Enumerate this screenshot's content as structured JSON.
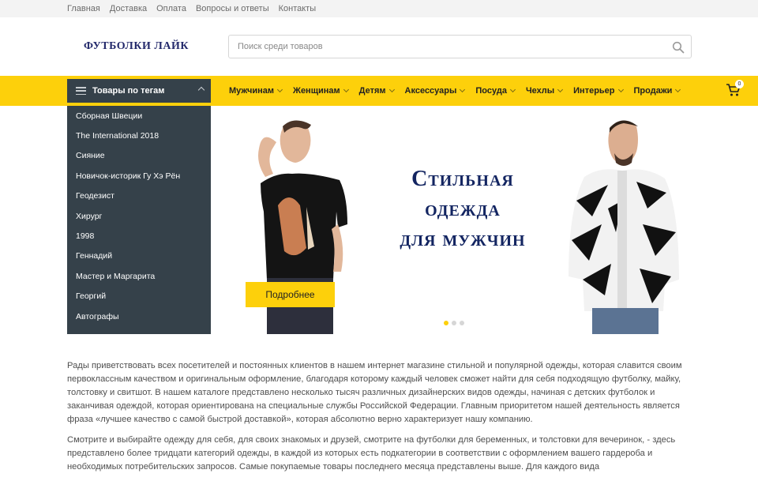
{
  "topnav": [
    "Главная",
    "Доставка",
    "Оплата",
    "Вопросы и ответы",
    "Контакты"
  ],
  "logo": "ФУТБОЛКИ ЛАЙК",
  "search": {
    "placeholder": "Поиск среди товаров",
    "icon": "search-icon"
  },
  "categories": {
    "title": "Товары по тегам",
    "items": [
      "Сборная Швеции",
      "The International 2018",
      "Сияние",
      "Новичок-историк Гу Хэ Рён",
      "Геодезист",
      "Хирург",
      "1998",
      "Геннадий",
      "Мастер и Маргарита",
      "Георгий",
      "Автографы"
    ]
  },
  "menu": [
    "Мужчинам",
    "Женщинам",
    "Детям",
    "Аксессуары",
    "Посуда",
    "Чехлы",
    "Интерьер",
    "Продажи"
  ],
  "cart": {
    "count": "0",
    "icon": "cart-icon"
  },
  "banner": {
    "lines": [
      "Стильная",
      "одежда",
      "для мужчин"
    ],
    "button": "Подробнее",
    "slides": 3,
    "active_slide": 1
  },
  "content": {
    "p1": "Рады приветствовать всех посетителей и постоянных клиентов в нашем интернет магазине стильной и популярной одежды, которая славится своим первоклассным качеством и оригинальным оформление, благодаря которому каждый человек сможет найти для себя подходящую футболку, майку, толстовку и свитшот. В нашем каталоге представлено несколько тысяч различных дизайнерских видов одежды, начиная с детских футболок и заканчивая одеждой, которая ориентирована на специальные службы Российской Федерации. Главным приоритетом нашей деятельность является фраза «лучшее качество с самой быстрой доставкой», которая абсолютно верно характеризует нашу компанию.",
    "p2": "Смотрите и выбирайте одежду для себя, для своих знакомых и друзей, смотрите на футболки для беременных, и толстовки для вечеринок, - здесь представлено более тридцати категорий одежды, в каждой из которых есть подкатегории в соответствии с оформлением вашего гардероба и необходимых потребительских запросов. Самые покупаемые товары последнего месяца представлены выше. Для каждого вида"
  },
  "colors": {
    "accent": "#fdd00b",
    "sidebar": "#35414a",
    "banner_text": "#132561",
    "logo": "#23296b"
  }
}
